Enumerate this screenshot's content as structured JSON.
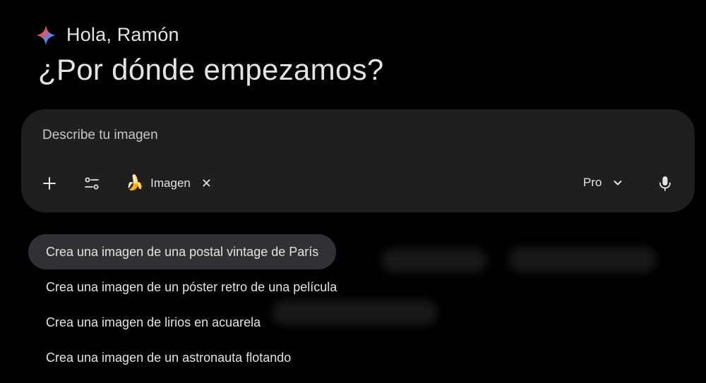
{
  "greeting": {
    "text": "Hola, Ramón",
    "icon": "gemini-sparkle-icon"
  },
  "headline": "¿Por dónde empezamos?",
  "prompt": {
    "placeholder": "Describe tu imagen",
    "value": ""
  },
  "toolbar": {
    "add_icon": "plus-icon",
    "tools_icon": "sliders-icon",
    "chip": {
      "emoji": "🍌",
      "label": "Imagen",
      "close": "✕"
    },
    "model": {
      "label": "Pro",
      "icon": "chevron-down-icon"
    },
    "mic_icon": "microphone-icon"
  },
  "suggestions": [
    "Crea una imagen de una postal vintage de París",
    "Crea una imagen de un póster retro de una película",
    "Crea una imagen de lirios en acuarela",
    "Crea una imagen de un astronauta flotando"
  ],
  "colors": {
    "background": "#000000",
    "prompt_box": "#1f1f20",
    "active_suggestion": "#303134",
    "text": "#e3e3e3"
  }
}
